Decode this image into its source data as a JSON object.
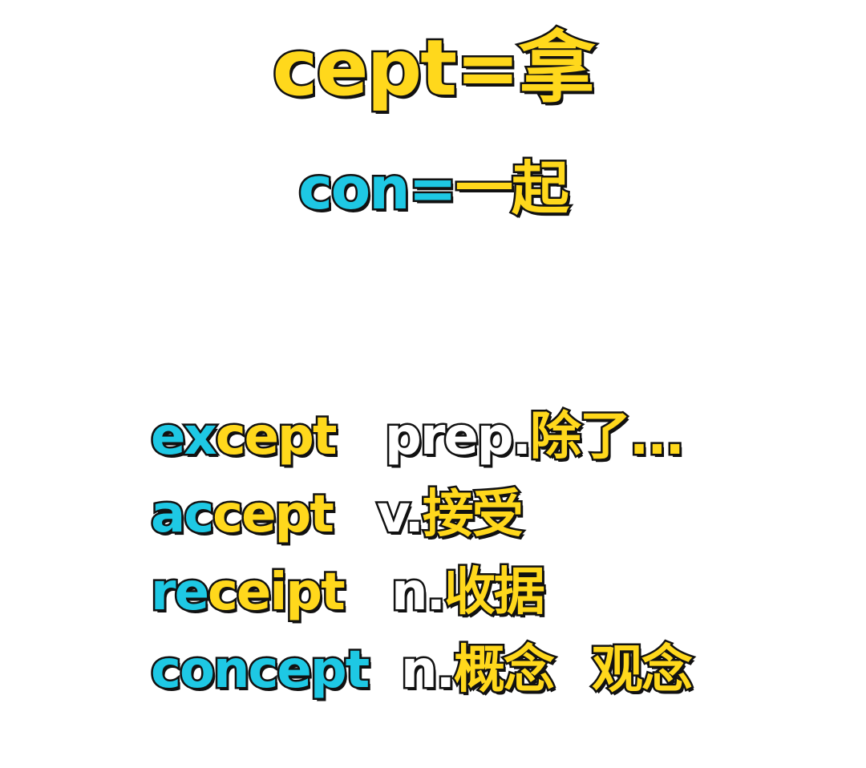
{
  "title": {
    "prefix": "cept=",
    "meaning": "拿"
  },
  "subtitle": {
    "prefix": "con=",
    "meaning": "一起"
  },
  "words": [
    {
      "highlight": "ex",
      "rest": "cept",
      "pos": "prep.",
      "meaning": "除了...",
      "meaning_2": ""
    },
    {
      "highlight": "ac",
      "rest": "cept",
      "pos": "v.",
      "meaning": "接受",
      "meaning_2": ""
    },
    {
      "highlight": "re",
      "rest": "ceipt",
      "pos": "n.",
      "meaning": "收据",
      "meaning_2": ""
    },
    {
      "highlight": "concept",
      "rest": "",
      "pos": "n.",
      "meaning": "概念",
      "meaning_2": "观念"
    }
  ],
  "colors": {
    "yellow": "#ffd81c",
    "cyan": "#1ec8e4",
    "white": "#ffffff",
    "outline": "#111111",
    "background": "#ffffff"
  }
}
